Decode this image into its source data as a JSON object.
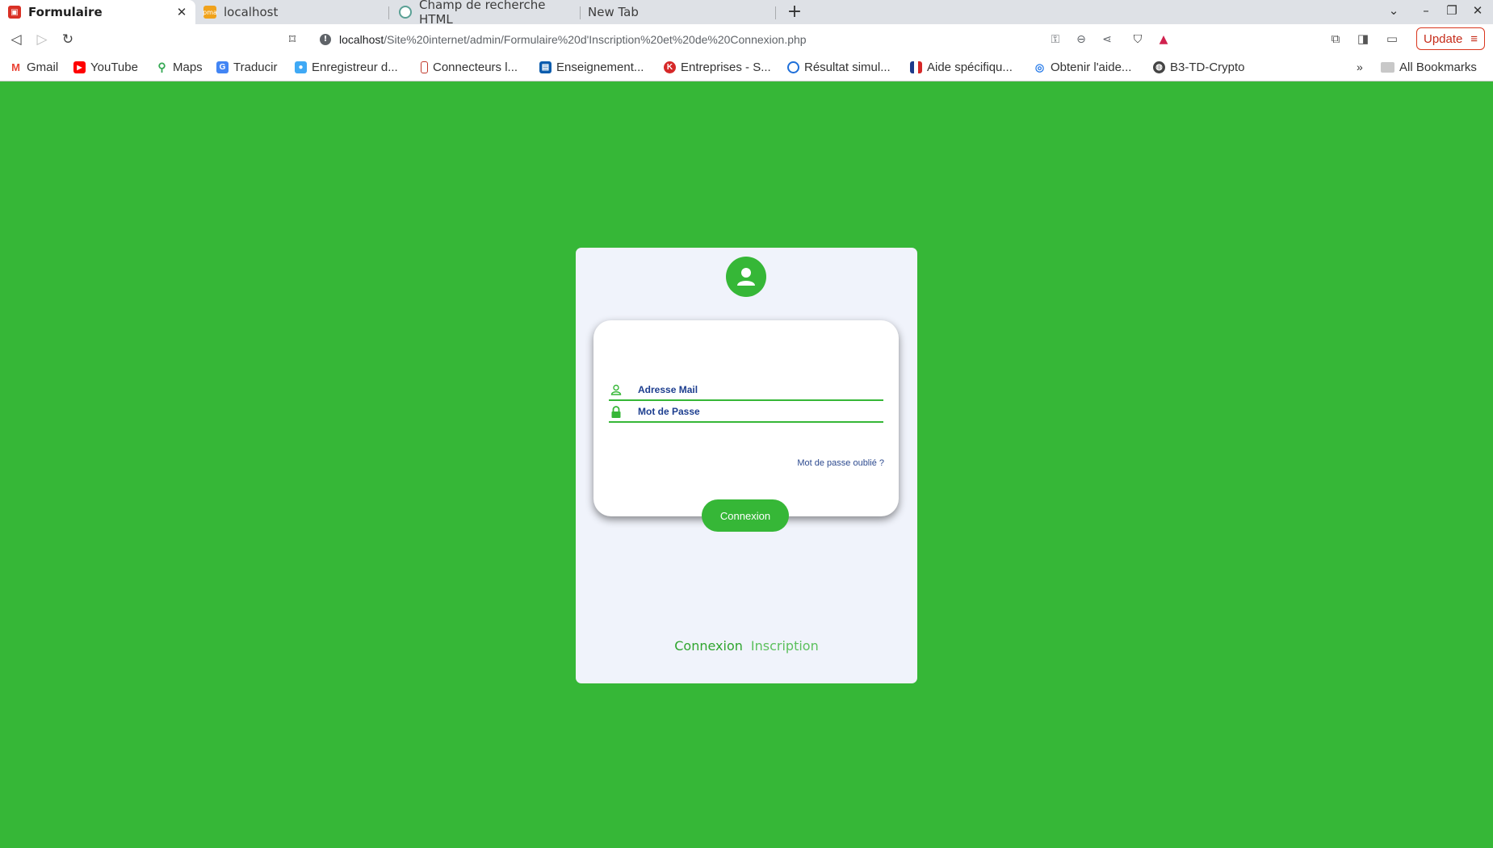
{
  "browser": {
    "tabs": [
      {
        "title": "Formulaire",
        "active": true
      },
      {
        "title": "localhost",
        "active": false
      },
      {
        "title": "Champ de recherche HTML",
        "active": false
      },
      {
        "title": "New Tab",
        "active": false
      }
    ],
    "url_host": "localhost",
    "url_path": "/Site%20internet/admin/Formulaire%20d'Inscription%20et%20de%20Connexion.php",
    "update_label": "Update",
    "bookmarks": [
      {
        "label": "Gmail",
        "icon": "gmail-icon",
        "color": "#ea4335"
      },
      {
        "label": "YouTube",
        "icon": "youtube-icon",
        "color": "#ff0000"
      },
      {
        "label": "Maps",
        "icon": "maps-icon",
        "color": "#34a853"
      },
      {
        "label": "Traducir",
        "icon": "translate-icon",
        "color": "#4285f4"
      },
      {
        "label": "Enregistreur d...",
        "icon": "recorder-icon",
        "color": "#3fa9f5"
      },
      {
        "label": "Connecteurs l...",
        "icon": "connector-icon",
        "color": "#c0392b"
      },
      {
        "label": "Enseignement...",
        "icon": "school-icon",
        "color": "#0b5cad"
      },
      {
        "label": "Entreprises - S...",
        "icon": "company-icon",
        "color": "#d62828"
      },
      {
        "label": "Résultat simul...",
        "icon": "result-icon",
        "color": "#1e6fd9"
      },
      {
        "label": "Aide spécifiqu...",
        "icon": "flag-icon",
        "color": "#1e3a8a"
      },
      {
        "label": "Obtenir l'aide...",
        "icon": "fingerprint-icon",
        "color": "#2b7de9"
      },
      {
        "label": "B3-TD-Crypto",
        "icon": "globe-icon",
        "color": "#444444"
      }
    ],
    "all_bookmarks_label": "All Bookmarks"
  },
  "form": {
    "email_placeholder": "Adresse Mail",
    "password_placeholder": "Mot de Passe",
    "forgot_label": "Mot de passe oublié ?",
    "submit_label": "Connexion",
    "tab_login": "Connexion",
    "tab_signup": "Inscription"
  },
  "colors": {
    "accent": "#36b737",
    "text_blue": "#1d3e8f",
    "panel_bg": "#f0f3fb"
  }
}
